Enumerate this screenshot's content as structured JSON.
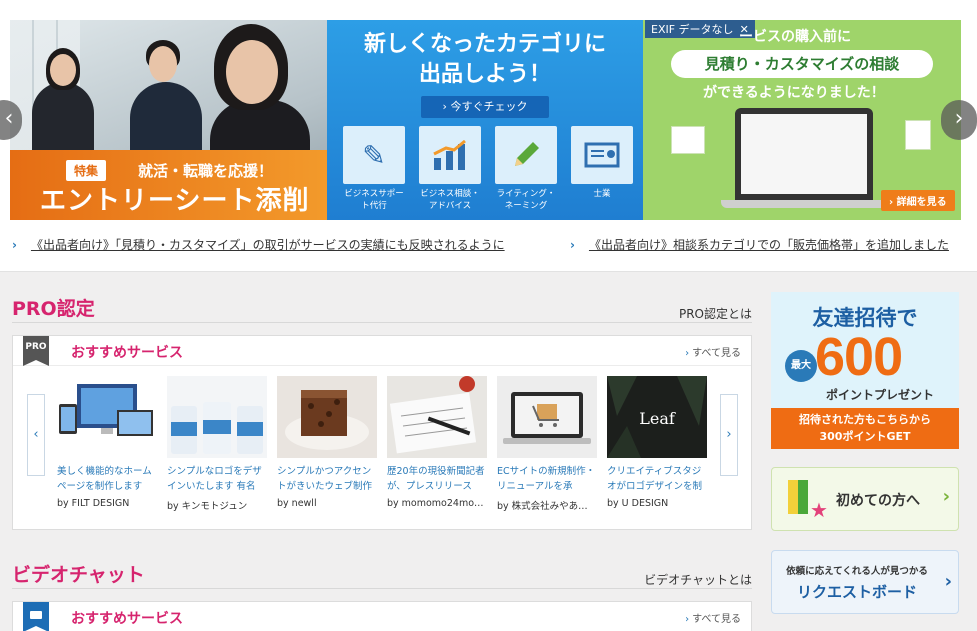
{
  "carousel": {
    "slide1": {
      "tag": "特集",
      "subtitle": "就活・転職を応援！",
      "title": "エントリーシート添削"
    },
    "slide2": {
      "headline_line1": "新しくなったカテゴリに",
      "headline_line2": "出品しよう！",
      "cta": "› 今すぐチェック",
      "tiles": [
        {
          "label": "ビジネスサポート代行",
          "icon": "document-pen-icon"
        },
        {
          "label": "ビジネス相談・アドバイス",
          "icon": "bar-chart-icon"
        },
        {
          "label": "ライティング・ネーミング",
          "icon": "pencil-icon"
        },
        {
          "label": "士業",
          "icon": "certificate-icon"
        }
      ]
    },
    "slide3": {
      "exif_label": "EXIF データなし",
      "exif_close": "✕",
      "line1": "ービスの購入前に",
      "pill": "見積り・カスタマイズの相談",
      "line2": "ができるようになりました！",
      "more": "› 詳細を見る"
    },
    "prev": "‹",
    "next": "›"
  },
  "news": [
    {
      "chevron": "›",
      "text": "《出品者向け》「見積り・カスタマイズ」の取引がサービスの実績にも反映されるように"
    },
    {
      "chevron": "›",
      "text": "《出品者向け》相談系カテゴリでの「販売価格帯」を追加しました"
    }
  ],
  "pro": {
    "section_title": "PRO認定",
    "section_link": "PRO認定とは",
    "badge": "PRO",
    "panel_title": "おすすめサービス",
    "see_all": "すべて見る",
    "see_all_chev": "›",
    "prev": "‹",
    "next": "›",
    "cards": [
      {
        "title": "美しく機能的なホームページを制作します",
        "by": "by FILT DESIGN"
      },
      {
        "title": "シンプルなロゴをデザインいたします 有名",
        "by": "by キンモトジュン"
      },
      {
        "title": "シンプルかつアクセントがきいたウェブ制作",
        "by": "by newll"
      },
      {
        "title": "歴20年の現役新聞記者が、プレスリリース",
        "by": "by momomo24mo…"
      },
      {
        "title": "ECサイトの新規制作・リニューアルを承",
        "by": "by 株式会社みやあ…"
      },
      {
        "title": "クリエイティブスタジオがロゴデザインを制",
        "by": "by U DESIGN"
      }
    ],
    "card6_logo": "Leaf"
  },
  "video": {
    "section_title": "ビデオチャット",
    "section_link": "ビデオチャットとは",
    "panel_title": "おすすめサービス",
    "see_all": "すべて見る",
    "see_all_chev": "›"
  },
  "sidebar": {
    "promo": {
      "title": "友達招待で",
      "max": "最大",
      "number": "600",
      "unit": "ポイントプレゼント",
      "bar_line1": "招待された方もこちらから",
      "bar_line2": "300ポイントGET"
    },
    "beginner": {
      "label": "初めての方へ",
      "chev": "›"
    },
    "request": {
      "line1": "依頼に応えてくれる人が見つかる",
      "line2": "リクエストボード",
      "chev": "›"
    }
  },
  "colors": {
    "accent_pink": "#d6246e",
    "link_blue": "#2a7ab8",
    "orange": "#ef6c13",
    "green": "#9fd46a"
  }
}
